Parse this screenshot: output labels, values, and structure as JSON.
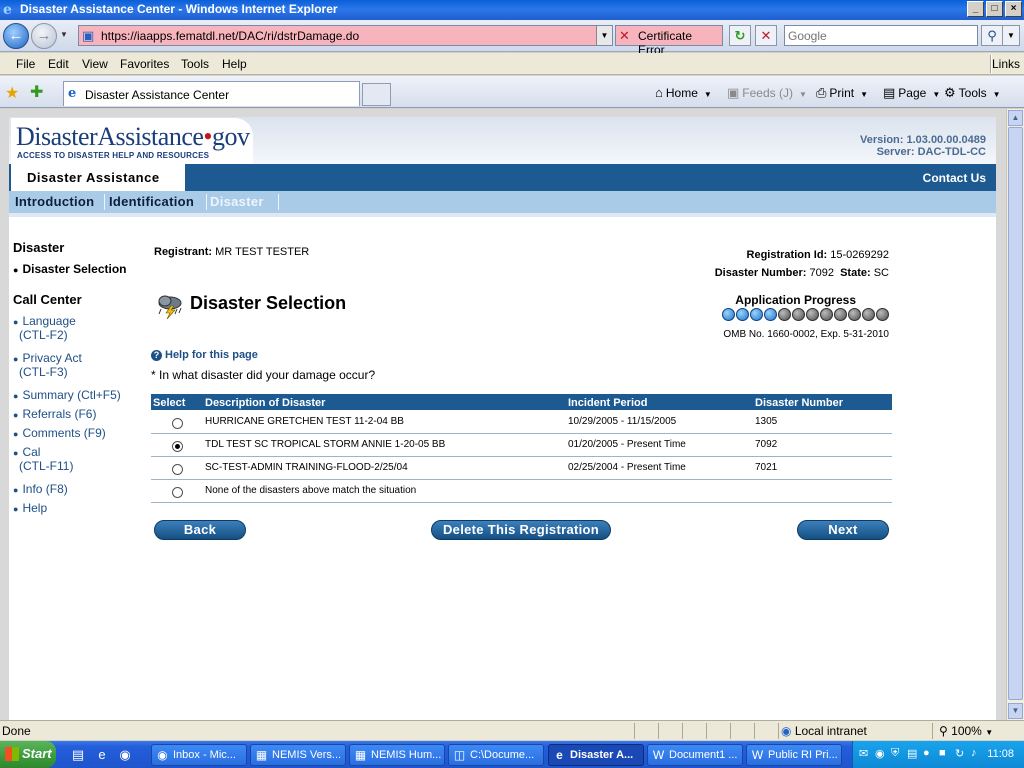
{
  "window": {
    "title": "Disaster Assistance Center - Windows Internet Explorer",
    "controls": [
      "_",
      "□",
      "×"
    ]
  },
  "address_bar": {
    "url": "https://iaapps.fematdl.net/DAC/ri/dstrDamage.do",
    "cert_error": "Certificate Error",
    "search_placeholder": "Google"
  },
  "menu": {
    "items": [
      "File",
      "Edit",
      "View",
      "Favorites",
      "Tools",
      "Help"
    ],
    "links": "Links"
  },
  "tabbar": {
    "tab_title": "Disaster Assistance Center",
    "commands": {
      "home": "Home",
      "feeds": "Feeds (J)",
      "print": "Print",
      "page": "Page",
      "tools": "Tools"
    }
  },
  "site": {
    "logo": {
      "name": "DisasterAssistance",
      "dot": "•",
      "tld": "gov",
      "tagline": "ACCESS TO DISASTER HELP AND RESOURCES"
    },
    "version": "Version: 1.03.00.00.0489",
    "server": "Server: DAC-TDL-CC",
    "section_tab": "Disaster Assistance",
    "contact_us": "Contact Us",
    "nav_tabs": [
      "Introduction",
      "Identification",
      "Disaster"
    ]
  },
  "left_nav": {
    "disaster_head": "Disaster",
    "disaster_items": [
      "Disaster Selection"
    ],
    "call_center_head": "Call Center",
    "call_center_items": [
      {
        "line1": "Language",
        "line2": "(CTL-F2)"
      },
      {
        "line1": "Privacy Act",
        "line2": "(CTL-F3)"
      },
      {
        "line1": "Summary (Ctl+F5)",
        "line2": ""
      },
      {
        "line1": "Referrals (F6)",
        "line2": ""
      },
      {
        "line1": "Comments (F9)",
        "line2": ""
      },
      {
        "line1": "Cal",
        "line2": "(CTL-F11)"
      },
      {
        "line1": "Info (F8)",
        "line2": ""
      },
      {
        "line1": "Help",
        "line2": ""
      }
    ]
  },
  "main": {
    "registrant_label": "Registrant:",
    "registrant_value": "MR TEST TESTER",
    "registration_id_label": "Registration Id:",
    "registration_id_value": "15-0269292",
    "disaster_number_label": "Disaster Number:",
    "disaster_number_value": "7092",
    "state_label": "State:",
    "state_value": "SC",
    "title": "Disaster Selection",
    "progress_label": "Application Progress",
    "progress": {
      "completed": 4,
      "total": 12
    },
    "omb": "OMB No. 1660-0002, Exp. 5-31-2010",
    "help_link": "Help for this page",
    "question": "* In what disaster did your damage occur?",
    "table": {
      "headers": [
        "Select",
        "Description of Disaster",
        "Incident Period",
        "Disaster Number"
      ],
      "rows": [
        {
          "selected": false,
          "description": "HURRICANE GRETCHEN TEST 11-2-04 BB",
          "period": "10/29/2005 - 11/15/2005",
          "number": "1305"
        },
        {
          "selected": true,
          "description": "TDL TEST SC TROPICAL STORM ANNIE 1-20-05 BB",
          "period": "01/20/2005 - Present Time",
          "number": "7092"
        },
        {
          "selected": false,
          "description": "SC-TEST-ADMIN TRAINING-FLOOD-2/25/04",
          "period": "02/25/2004 - Present Time",
          "number": "7021"
        },
        {
          "selected": false,
          "description": "None of the disasters above match the situation",
          "period": "",
          "number": ""
        }
      ]
    },
    "buttons": {
      "back": "Back",
      "delete": "Delete This Registration",
      "next": "Next"
    }
  },
  "status_bar": {
    "status": "Done",
    "zone": "Local intranet",
    "zoom": "100%"
  },
  "taskbar": {
    "start": "Start",
    "tasks": [
      {
        "label": "Inbox - Mic...",
        "icon": "outlook-icon"
      },
      {
        "label": "NEMIS Vers...",
        "icon": "app-icon"
      },
      {
        "label": "NEMIS Hum...",
        "icon": "app-icon"
      },
      {
        "label": "C:\\Docume...",
        "icon": "folder-icon"
      },
      {
        "label": "Disaster A...",
        "icon": "ie-icon",
        "active": true
      },
      {
        "label": "Document1 ...",
        "icon": "word-icon"
      },
      {
        "label": "Public RI Pri...",
        "icon": "word-icon"
      }
    ],
    "clock": "11:08"
  }
}
